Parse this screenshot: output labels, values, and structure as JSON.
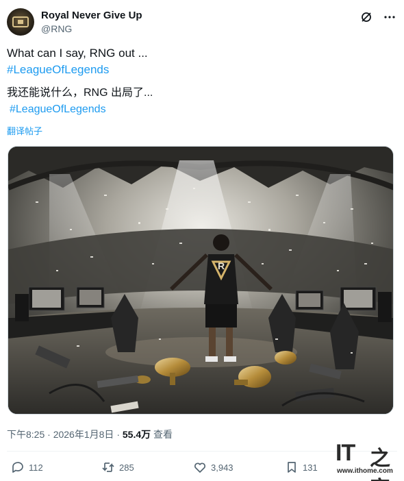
{
  "author": {
    "display_name": "Royal Never Give Up",
    "handle": "@RNG"
  },
  "header_icons": [
    "grok-icon",
    "more-icon"
  ],
  "tweet": {
    "text_en": "What can I say, RNG out ...",
    "hashtag_en": "#LeagueOfLegends",
    "text_zh": "我还能说什么，RNG 出局了...",
    "hashtag_zh": "#LeagueOfLegends",
    "translate_label": "翻译帖子"
  },
  "media": {
    "kind": "image",
    "jersey_logo": "R"
  },
  "meta": {
    "time": "下午8:25",
    "sep1": "·",
    "date": "2026年1月8日",
    "sep2": "·",
    "views": "55.4万",
    "views_label": "查看"
  },
  "actions": {
    "replies": "112",
    "reposts": "285",
    "likes": "3,943",
    "bookmarks": "131"
  },
  "watermark": {
    "it": "IT",
    "zh": "之家",
    "url": "www.ithome.com"
  },
  "colors": {
    "link": "#1d9bf0",
    "secondary": "#536471",
    "text": "#0f1419"
  }
}
